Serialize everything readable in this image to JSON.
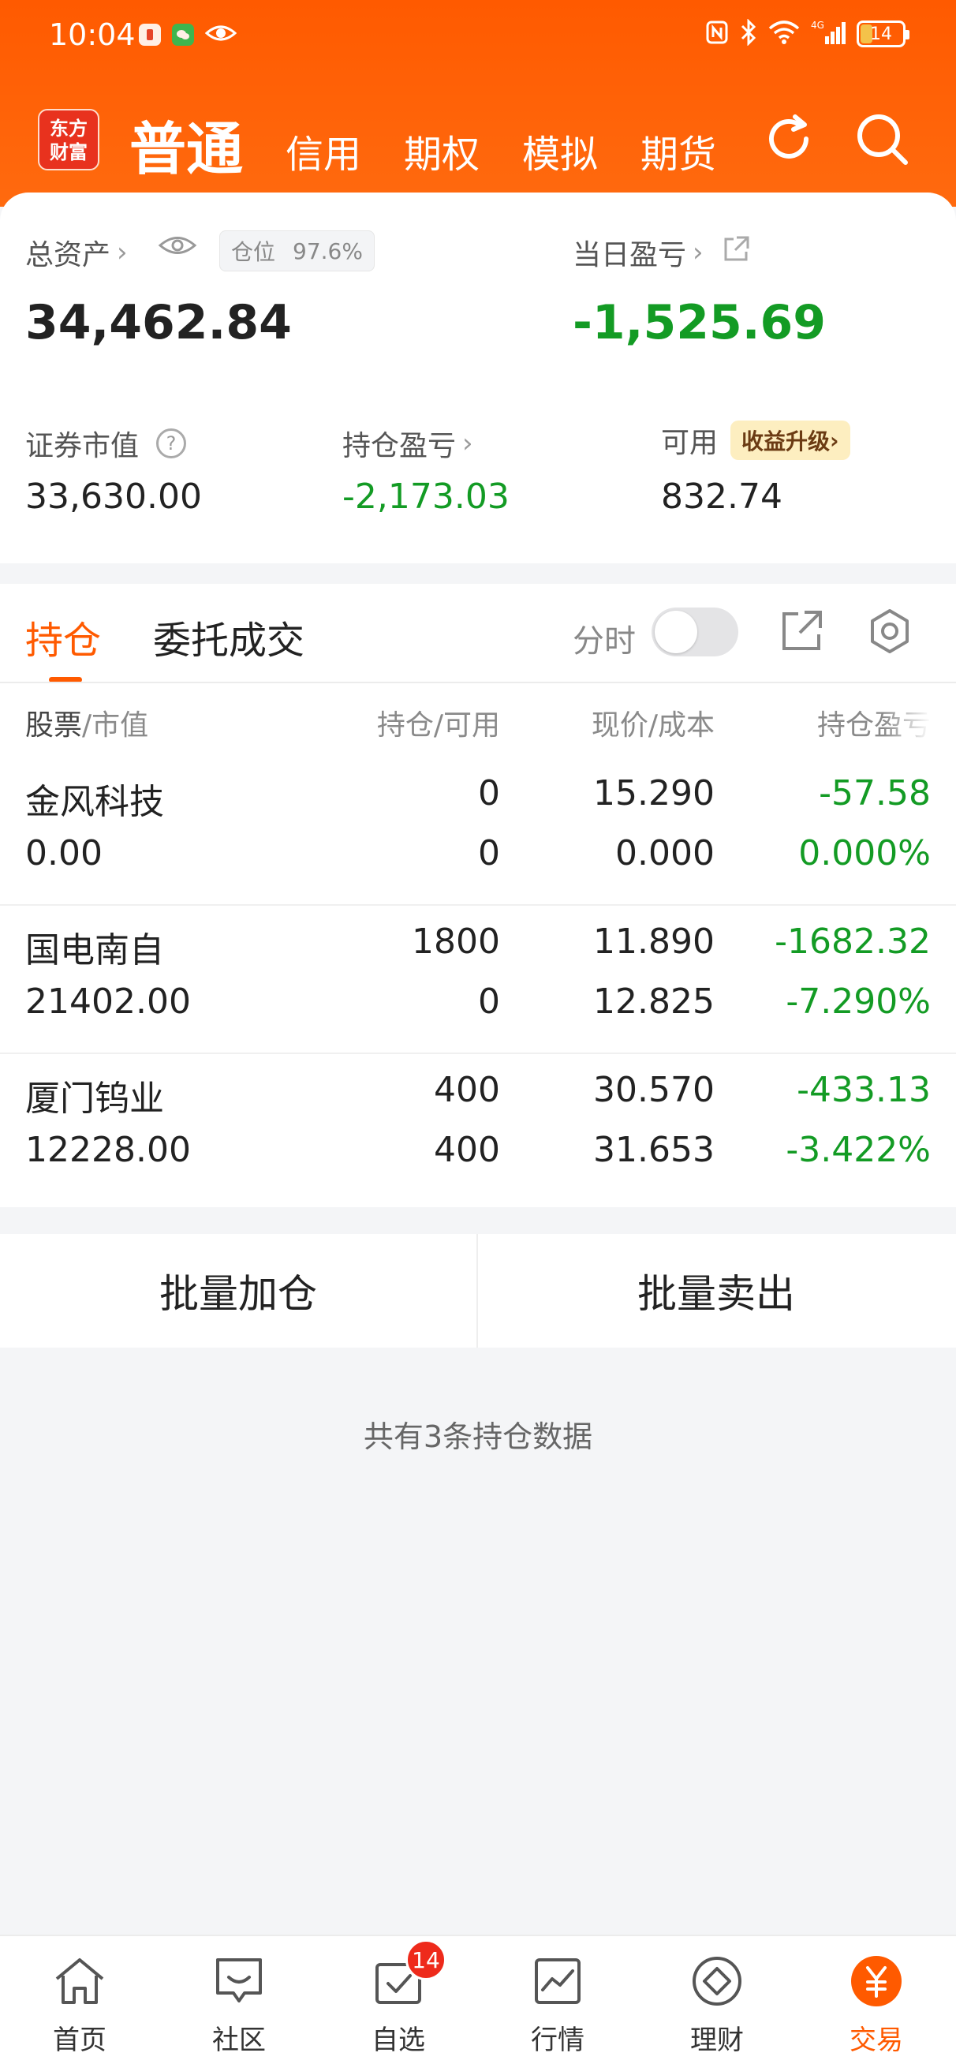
{
  "status_bar": {
    "time": "10:04",
    "battery": "14"
  },
  "header": {
    "logo_line1": "东方",
    "logo_line2": "财富",
    "tabs": [
      {
        "label": "普通"
      },
      {
        "label": "信用"
      },
      {
        "label": "期权"
      },
      {
        "label": "模拟"
      },
      {
        "label": "期货"
      }
    ],
    "icons": [
      "refresh-icon",
      "search-icon"
    ]
  },
  "summary": {
    "total_assets_label": "总资产",
    "position_ratio_label": "仓位",
    "position_ratio_value": "97.6%",
    "total_assets_value": "34,462.84",
    "daily_pnl_label": "当日盈亏",
    "daily_pnl_value": "-1,525.69",
    "market_value_label": "证券市值",
    "market_value": "33,630.00",
    "holding_pnl_label": "持仓盈亏",
    "holding_pnl_value": "-2,173.03",
    "available_label": "可用",
    "upgrade_label": "收益升级",
    "available_value": "832.74"
  },
  "holdings": {
    "tabs": [
      {
        "label": "持仓"
      },
      {
        "label": "委托成交"
      }
    ],
    "split_label": "分时",
    "columns": {
      "stock_prefix": "股票",
      "stock_suffix": "/市值",
      "qty": "持仓/可用",
      "price": "现价/成本",
      "pnl": "持仓盈亏"
    },
    "rows": [
      {
        "name": "金风科技",
        "market_value": "0.00",
        "qty": "0",
        "available": "0",
        "price": "15.290",
        "cost": "0.000",
        "pnl": "-57.58",
        "pct": "0.000%"
      },
      {
        "name": "国电南自",
        "market_value": "21402.00",
        "qty": "1800",
        "available": "0",
        "price": "11.890",
        "cost": "12.825",
        "pnl": "-1682.32",
        "pct": "-7.290%"
      },
      {
        "name": "厦门钨业",
        "market_value": "12228.00",
        "qty": "400",
        "available": "400",
        "price": "30.570",
        "cost": "31.653",
        "pnl": "-433.13",
        "pct": "-3.422%"
      }
    ]
  },
  "batch": {
    "add_label": "批量加仓",
    "sell_label": "批量卖出"
  },
  "count_text": "共有3条持仓数据",
  "bottom_nav": {
    "items": [
      {
        "label": "首页"
      },
      {
        "label": "社区"
      },
      {
        "label": "自选",
        "badge": "14"
      },
      {
        "label": "行情"
      },
      {
        "label": "理财"
      },
      {
        "label": "交易"
      }
    ]
  },
  "colors": {
    "accent": "#ff5a00",
    "loss_green": "#139b24"
  }
}
